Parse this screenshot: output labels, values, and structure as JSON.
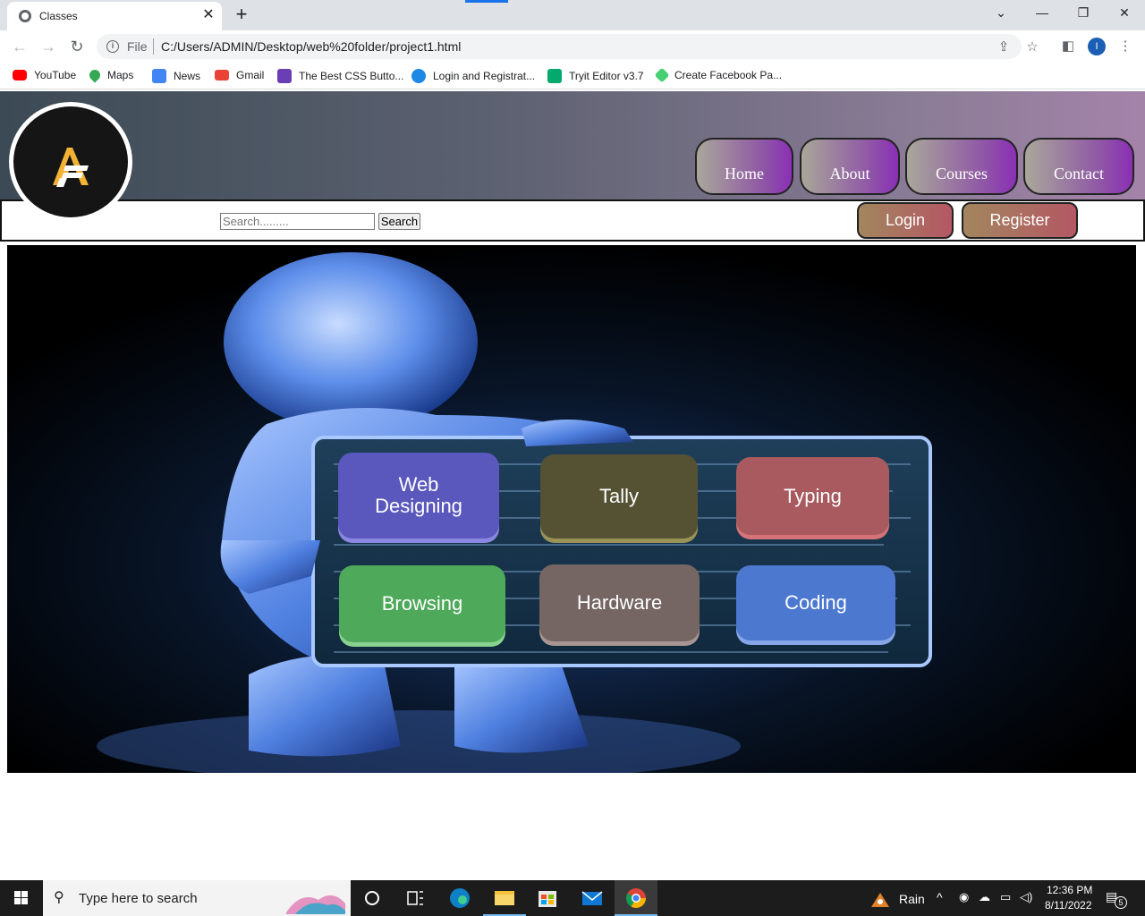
{
  "browser": {
    "tab_title": "Classes",
    "tab_close_glyph": "✕",
    "new_tab_glyph": "+",
    "url_scheme": "File",
    "url_path": "C:/Users/ADMIN/Desktop/web%20folder/project1.html",
    "profile_initial": "I",
    "window_controls": [
      "⌄",
      "—",
      "❐",
      "✕"
    ]
  },
  "bookmarks": [
    {
      "label": "YouTube",
      "icon": "youtube-icon",
      "color": "#ff0000"
    },
    {
      "label": "Maps",
      "icon": "maps-icon",
      "color": "#34a853"
    },
    {
      "label": "News",
      "icon": "news-icon",
      "color": "#4285f4"
    },
    {
      "label": "Gmail",
      "icon": "gmail-icon",
      "color": "#ea4335"
    },
    {
      "label": "The Best CSS Butto...",
      "icon": "css-icon",
      "color": "#6a3fb5"
    },
    {
      "label": "Login and Registrat...",
      "icon": "cn-icon",
      "color": "#1e88e5"
    },
    {
      "label": "Tryit Editor v3.7",
      "icon": "w3-icon",
      "color": "#04aa6d"
    },
    {
      "label": "Create Facebook Pa...",
      "icon": "codepen-icon",
      "color": "#47cf73"
    }
  ],
  "site": {
    "nav": [
      "Home",
      "About",
      "Courses",
      "Contact"
    ],
    "search_placeholder": "Search.........",
    "search_button": "Search",
    "login": "Login",
    "register": "Register",
    "courses": [
      {
        "label": "Web Designing",
        "color": "#5a58bd"
      },
      {
        "label": "Tally",
        "color": "#555234"
      },
      {
        "label": "Typing",
        "color": "#a85a5f"
      },
      {
        "label": "Browsing",
        "color": "#4fa95a"
      },
      {
        "label": "Hardware",
        "color": "#756664"
      },
      {
        "label": "Coding",
        "color": "#4c78d0"
      }
    ]
  },
  "taskbar": {
    "search_text": "Type here to search",
    "weather": "Rain",
    "time": "12:36 PM",
    "date": "8/11/2022",
    "notification_count": "5"
  }
}
